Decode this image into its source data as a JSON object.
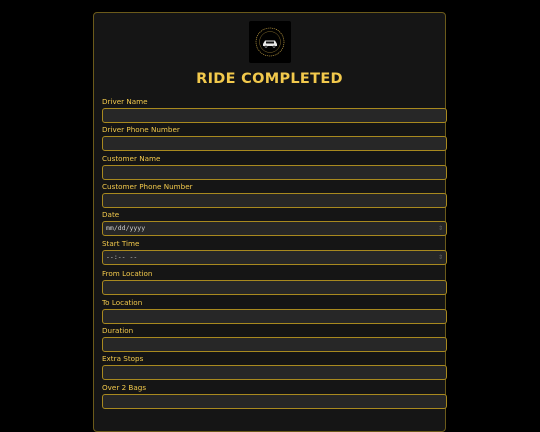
{
  "form": {
    "title": "RIDE COMPLETED",
    "logo_icon": "car-logo-icon",
    "colors": {
      "accent": "#f2c94c",
      "border": "#a8891f",
      "card_bg": "#151515",
      "input_bg": "#272727",
      "page_bg": "#000000"
    },
    "fields": [
      {
        "label": "Driver Name",
        "value": "",
        "type": "text"
      },
      {
        "label": "Driver Phone Number",
        "value": "",
        "type": "text"
      },
      {
        "label": "Customer Name",
        "value": "",
        "type": "text"
      },
      {
        "label": "Customer Phone Number",
        "value": "",
        "type": "text"
      },
      {
        "label": "Date",
        "placeholder": "mm/dd/yyyy",
        "type": "date"
      },
      {
        "label": "Start Time",
        "placeholder": "--:-- --",
        "type": "time"
      },
      {
        "label": "From Location",
        "value": "",
        "type": "text"
      },
      {
        "label": "To Location",
        "value": "",
        "type": "text"
      },
      {
        "label": "Duration",
        "value": "",
        "type": "text"
      },
      {
        "label": "Extra Stops",
        "value": "",
        "type": "text"
      },
      {
        "label": "Over 2 Bags",
        "value": "",
        "type": "text"
      }
    ]
  }
}
